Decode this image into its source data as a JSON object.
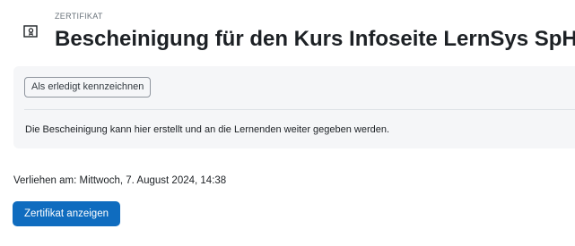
{
  "header": {
    "module_type": "ZERTIFIKAT",
    "title": "Bescheinigung für den Kurs Infoseite LernSys SpH",
    "icon": "certificate-icon"
  },
  "activity": {
    "mark_done_label": "Als erledigt kennzeichnen",
    "description": "Die Bescheinigung kann hier erstellt und an die Lernenden weiter gegeben werden."
  },
  "awarded": {
    "text": "Verliehen am: Mittwoch, 7. August 2024, 14:38"
  },
  "actions": {
    "view_certificate_label": "Zertifikat anzeigen"
  },
  "colors": {
    "primary": "#0f6cbf",
    "panel_bg": "#f5f6f8"
  }
}
